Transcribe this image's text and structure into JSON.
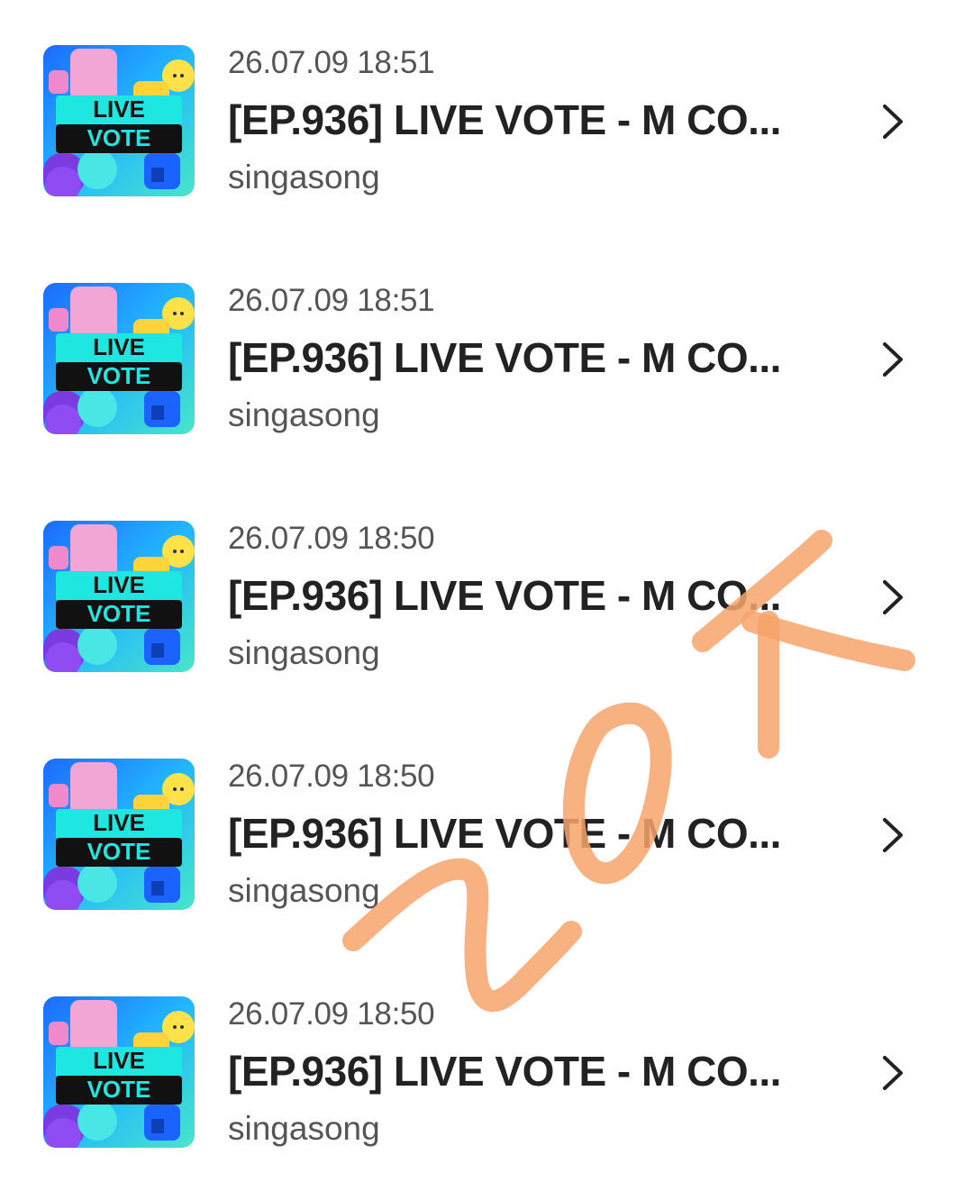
{
  "items": [
    {
      "date": "26.07.09 18:51",
      "title": "[EP.936] LIVE VOTE - M CO...",
      "author": "singasong",
      "thumb_text_1": "LIVE",
      "thumb_text_2": "VOTE"
    },
    {
      "date": "26.07.09 18:51",
      "title": "[EP.936] LIVE VOTE - M CO...",
      "author": "singasong",
      "thumb_text_1": "LIVE",
      "thumb_text_2": "VOTE"
    },
    {
      "date": "26.07.09 18:50",
      "title": "[EP.936] LIVE VOTE - M CO...",
      "author": "singasong",
      "thumb_text_1": "LIVE",
      "thumb_text_2": "VOTE"
    },
    {
      "date": "26.07.09 18:50",
      "title": "[EP.936] LIVE VOTE - M CO...",
      "author": "singasong",
      "thumb_text_1": "LIVE",
      "thumb_text_2": "VOTE"
    },
    {
      "date": "26.07.09 18:50",
      "title": "[EP.936] LIVE VOTE - M CO...",
      "author": "singasong",
      "thumb_text_1": "LIVE",
      "thumb_text_2": "VOTE"
    }
  ],
  "icons": {
    "row_arrow": "chevron-right-icon"
  },
  "annotation": {
    "text": "20K",
    "color": "#f7a36a"
  },
  "colors": {
    "accent_cyan": "#1ee6e0",
    "thumb_bg": "#2fa8ff",
    "text_dark": "#222222",
    "text_muted": "#555555"
  }
}
